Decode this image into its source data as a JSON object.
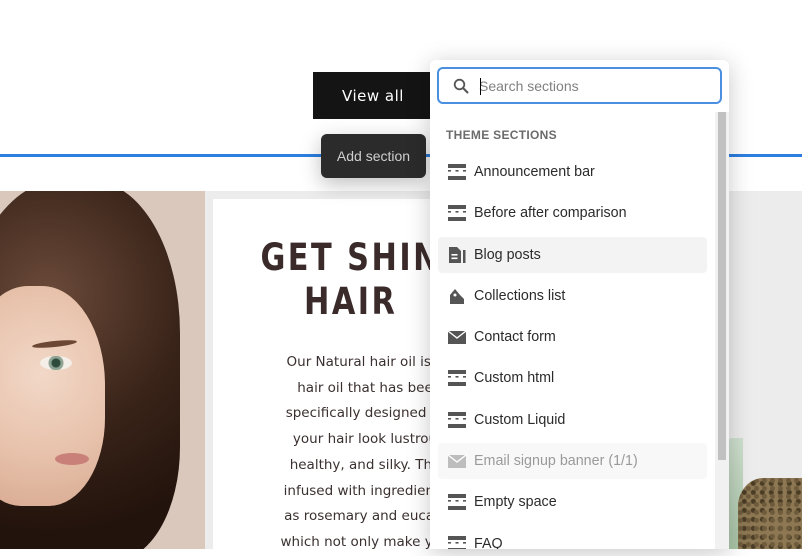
{
  "page": {
    "view_all_label": "View all",
    "add_section_label": "Add section",
    "heading": "GET SHIN\nHAIR",
    "body_text": "Our Natural hair oil is a\nhair oil that has bee\nspecifically designed to\nyour hair look lustrou\nhealthy, and silky. The\ninfused with ingredients\nas rosemary and eucaly\nwhich not only make you"
  },
  "picker": {
    "search_placeholder": "Search sections",
    "search_value": "",
    "section_heading": "THEME SECTIONS",
    "items": [
      {
        "label": "Announcement bar",
        "icon": "section-icon",
        "state": "normal"
      },
      {
        "label": "Before after comparison",
        "icon": "section-icon",
        "state": "normal"
      },
      {
        "label": "Blog posts",
        "icon": "blog-icon",
        "state": "highlighted"
      },
      {
        "label": "Collections list",
        "icon": "tag-icon",
        "state": "normal"
      },
      {
        "label": "Contact form",
        "icon": "envelope-icon",
        "state": "normal"
      },
      {
        "label": "Custom html",
        "icon": "section-icon",
        "state": "normal"
      },
      {
        "label": "Custom Liquid",
        "icon": "section-icon",
        "state": "normal"
      },
      {
        "label": "Email signup banner (1/1)",
        "icon": "envelope-icon",
        "state": "disabled"
      },
      {
        "label": "Empty space",
        "icon": "section-icon",
        "state": "normal"
      },
      {
        "label": "FAQ",
        "icon": "section-icon",
        "state": "normal"
      }
    ]
  },
  "colors": {
    "accent_blue": "#2c7ee0",
    "dark_button": "#141414",
    "heading_text": "#3a2a2a"
  }
}
